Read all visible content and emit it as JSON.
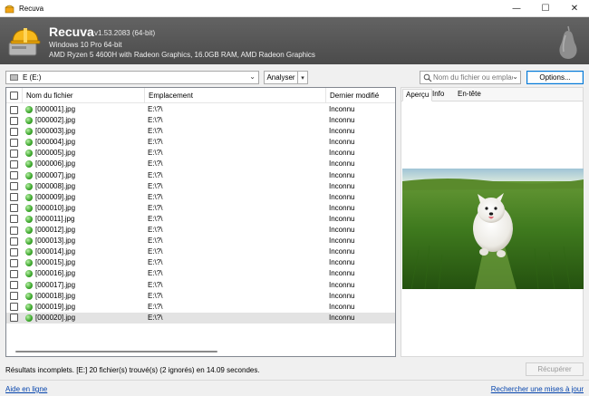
{
  "window": {
    "title": "Recuva",
    "icon": "recuva-app-icon",
    "controls": {
      "minimize": "—",
      "maximize": "☐",
      "close": "✕"
    }
  },
  "header": {
    "app_name": "Recuva",
    "version": "v1.53.2083 (64-bit)",
    "os_line": "Windows 10 Pro 64-bit",
    "hw_line": "AMD Ryzen 5 4600H with Radeon Graphics, 16.0GB RAM, AMD Radeon Graphics"
  },
  "toolbar": {
    "drive_value": "E (E:)",
    "scan_label": "Analyser",
    "search_placeholder": "Nom du fichier ou emplacement",
    "options_label": "Options..."
  },
  "table": {
    "columns": [
      "Nom du fichier",
      "Emplacement",
      "Dernier modifié"
    ],
    "selected_index": 19,
    "rows": [
      {
        "name": "[000001].jpg",
        "path": "E:\\?\\",
        "modified": "Inconnu"
      },
      {
        "name": "[000002].jpg",
        "path": "E:\\?\\",
        "modified": "Inconnu"
      },
      {
        "name": "[000003].jpg",
        "path": "E:\\?\\",
        "modified": "Inconnu"
      },
      {
        "name": "[000004].jpg",
        "path": "E:\\?\\",
        "modified": "Inconnu"
      },
      {
        "name": "[000005].jpg",
        "path": "E:\\?\\",
        "modified": "Inconnu"
      },
      {
        "name": "[000006].jpg",
        "path": "E:\\?\\",
        "modified": "Inconnu"
      },
      {
        "name": "[000007].jpg",
        "path": "E:\\?\\",
        "modified": "Inconnu"
      },
      {
        "name": "[000008].jpg",
        "path": "E:\\?\\",
        "modified": "Inconnu"
      },
      {
        "name": "[000009].jpg",
        "path": "E:\\?\\",
        "modified": "Inconnu"
      },
      {
        "name": "[000010].jpg",
        "path": "E:\\?\\",
        "modified": "Inconnu"
      },
      {
        "name": "[000011].jpg",
        "path": "E:\\?\\",
        "modified": "Inconnu"
      },
      {
        "name": "[000012].jpg",
        "path": "E:\\?\\",
        "modified": "Inconnu"
      },
      {
        "name": "[000013].jpg",
        "path": "E:\\?\\",
        "modified": "Inconnu"
      },
      {
        "name": "[000014].jpg",
        "path": "E:\\?\\",
        "modified": "Inconnu"
      },
      {
        "name": "[000015].jpg",
        "path": "E:\\?\\",
        "modified": "Inconnu"
      },
      {
        "name": "[000016].jpg",
        "path": "E:\\?\\",
        "modified": "Inconnu"
      },
      {
        "name": "[000017].jpg",
        "path": "E:\\?\\",
        "modified": "Inconnu"
      },
      {
        "name": "[000018].jpg",
        "path": "E:\\?\\",
        "modified": "Inconnu"
      },
      {
        "name": "[000019].jpg",
        "path": "E:\\?\\",
        "modified": "Inconnu"
      },
      {
        "name": "[000020].jpg",
        "path": "E:\\?\\",
        "modified": "Inconnu"
      }
    ]
  },
  "preview": {
    "tabs": [
      "Aperçu",
      "Info",
      "En-tête"
    ],
    "active_tab": "Aperçu"
  },
  "status": {
    "text": "Résultats incomplets. [E:] 20 fichier(s) trouvé(s) (2 ignorés) en 14.09 secondes.",
    "recover_label": "Récupérer"
  },
  "footer": {
    "help_link": "Aide en ligne",
    "update_link": "Rechercher une mises à jour"
  },
  "colors": {
    "header_bg": "#555555",
    "link": "#0645ad",
    "state_dot": "#3aa52a",
    "options_border": "#0078d7"
  }
}
